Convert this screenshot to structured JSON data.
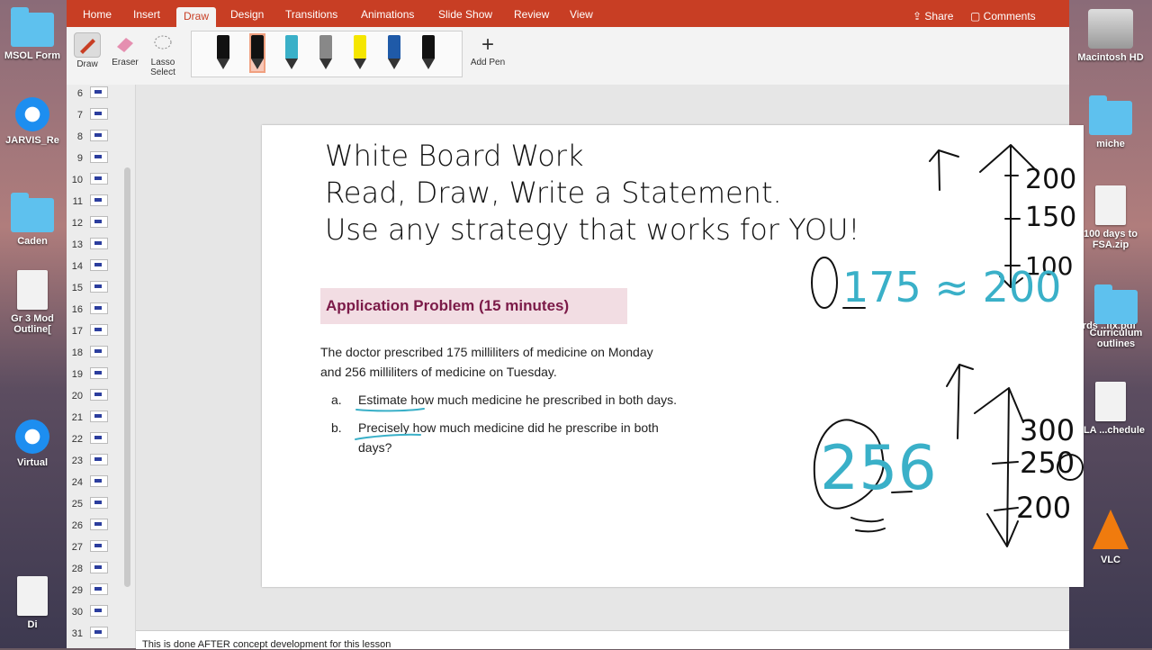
{
  "desktop": {
    "left_icons": [
      {
        "label": "MSOL Form",
        "kind": "folder"
      },
      {
        "label": "JARVIS_Re",
        "kind": "safari"
      },
      {
        "label": "Caden",
        "kind": "folder"
      },
      {
        "label": "Gr 3 Mod Outline[",
        "kind": "doc"
      },
      {
        "label": "Virtual",
        "kind": "safari"
      },
      {
        "label": "Di",
        "kind": "doc"
      }
    ],
    "right_icons": [
      {
        "label": "Macintosh HD",
        "kind": "hdd"
      },
      {
        "label": "miche",
        "kind": "folder"
      },
      {
        "label": "100 days to FSA.zip",
        "kind": "zip"
      },
      {
        "label": "Words ..fix.pdf",
        "kind": "doc"
      },
      {
        "label": "Curriculum outlines",
        "kind": "folder"
      },
      {
        "label": "RLA ...chedule",
        "kind": "doc"
      },
      {
        "label": "VLC",
        "kind": "vlc"
      }
    ]
  },
  "ribbon": {
    "tabs": [
      "Home",
      "Insert",
      "Draw",
      "Design",
      "Transitions",
      "Animations",
      "Slide Show",
      "Review",
      "View"
    ],
    "active_tab": "Draw",
    "share_label": "Share",
    "comments_label": "Comments"
  },
  "toolbar": {
    "draw_label": "Draw",
    "eraser_label": "Eraser",
    "lasso_label": "Lasso Select",
    "add_pen_label": "Add Pen",
    "pen_colors": [
      "#111111",
      "#111111",
      "#3ab0c8",
      "#888888",
      "#f5e600",
      "#1f5aa8",
      "#111111"
    ]
  },
  "thumbnails": [
    "6",
    "7",
    "8",
    "9",
    "10",
    "11",
    "12",
    "13",
    "14",
    "15",
    "16",
    "17",
    "18",
    "19",
    "20",
    "21",
    "22",
    "23",
    "24",
    "25",
    "26",
    "27",
    "28",
    "29",
    "30",
    "31"
  ],
  "slide": {
    "title_lines": [
      "White Board Work",
      "Read, Draw, Write a Statement.",
      "Use any strategy that works for YOU!"
    ],
    "app_problem_label": "Application Problem  (15 minutes)",
    "problem_text_1": "The doctor prescribed 175 milliliters of medicine on Monday",
    "problem_text_2": "and 256 milliliters of medicine on Tuesday.",
    "item_a_letter": "a.",
    "item_a_text": "Estimate how much medicine he prescribed in both days.",
    "item_b_letter": "b.",
    "item_b_text_1": "Precisely how much medicine did he prescribe in both",
    "item_b_text_2": "days?",
    "ink": {
      "numbers_top": [
        "200",
        "150",
        "100"
      ],
      "approx_top": "175 ≈ 200",
      "numbers_bottom": [
        "300",
        "250",
        "200"
      ],
      "big_number": "256"
    }
  },
  "notes": "This is done AFTER concept development for this lesson"
}
